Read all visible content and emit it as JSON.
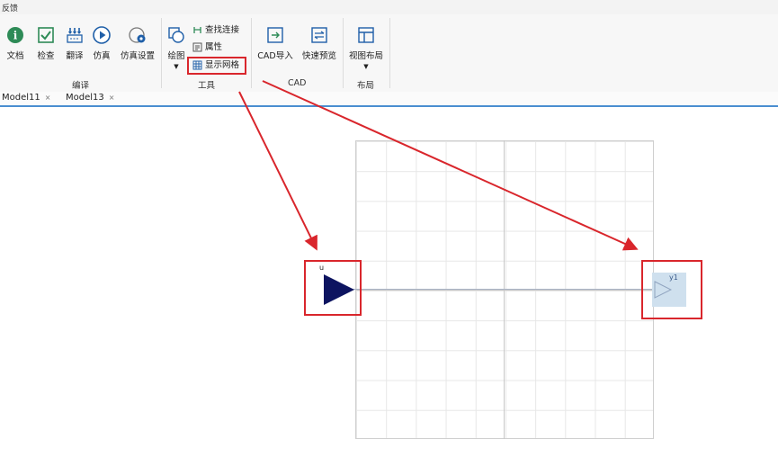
{
  "window": {
    "title": "反馈"
  },
  "ribbon": {
    "buttons": {
      "doc": "文档",
      "check": "检查",
      "translate": "翻译",
      "simulate": "仿真",
      "sim_settings": "仿真设置",
      "draw": "绘图",
      "find_conn": "查找连接",
      "properties": "属性",
      "show_grid": "显示网格",
      "cad_import": "CAD导入",
      "quick_preview": "快速预览",
      "view_layout": "视图布局"
    },
    "groups": {
      "compile": "编译",
      "tools": "工具",
      "cad": "CAD",
      "layout": "布局"
    }
  },
  "tabs": [
    {
      "label": "Model11",
      "close": "×"
    },
    {
      "label": "Model13",
      "close": "×"
    }
  ],
  "diagram": {
    "input_block_label": "u",
    "output_block_label": "y1"
  },
  "colors": {
    "highlight": "#d9262c",
    "arrow": "#d9262c",
    "input_block": "#0d1460",
    "output_block_bg": "#cfe0ee",
    "tab_underline": "#4a8ed0"
  }
}
